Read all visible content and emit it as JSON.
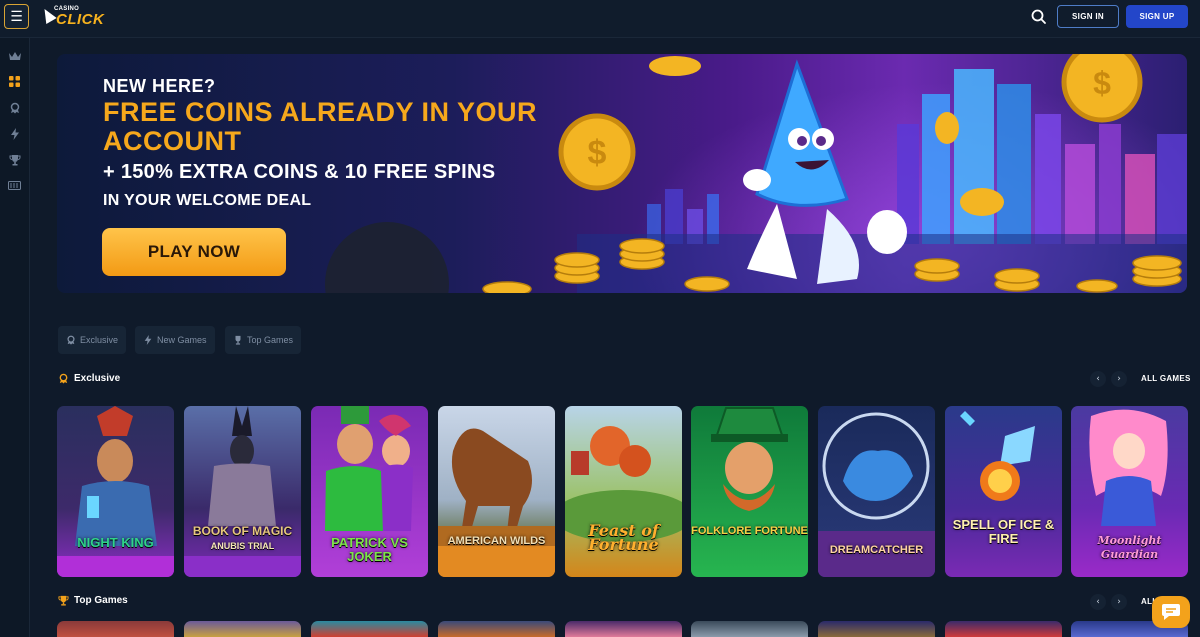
{
  "header": {
    "logo_small": "CASINO",
    "logo_main": "CLICK",
    "sign_in": "SIGN IN",
    "sign_up": "SIGN UP"
  },
  "sidebar": {
    "icons": [
      "crown-icon",
      "grid-icon",
      "exclusive-icon",
      "lightning-icon",
      "trophy-icon",
      "ticket-icon"
    ]
  },
  "hero": {
    "line1": "NEW HERE?",
    "line2": "FREE COINS ALREADY IN YOUR ACCOUNT",
    "line3": "+ 150% EXTRA COINS & 10 FREE SPINS",
    "line4": "IN YOUR WELCOME DEAL",
    "cta": "PLAY NOW"
  },
  "filters": [
    {
      "label": "Exclusive",
      "icon": "exclusive-icon"
    },
    {
      "label": "New Games",
      "icon": "lightning-icon"
    },
    {
      "label": "Top Games",
      "icon": "trophy-icon"
    }
  ],
  "sections": {
    "exclusive": {
      "title": "Exclusive",
      "all": "ALL GAMES"
    },
    "top_games": {
      "title": "Top Games",
      "all": "ALL"
    }
  },
  "games": [
    {
      "title": "NIGHT KING",
      "color": "#2fd38a"
    },
    {
      "title": "BOOK OF MAGIC",
      "subtitle": "ANUBIS TRIAL",
      "color": "#e7c77d"
    },
    {
      "title": "PATRICK VS JOKER",
      "color": "#7de34a"
    },
    {
      "title": "AMERICAN WILDS",
      "color": "#f2dfb5"
    },
    {
      "title": "Feast of Fortune",
      "color": "#ffb02e"
    },
    {
      "title": "FOLKLORE FORTUNE",
      "color": "#f7d046"
    },
    {
      "title": "DREAMCATCHER",
      "color": "#ffd4a0"
    },
    {
      "title": "SPELL OF ICE & FIRE",
      "color": "#fff0b0"
    },
    {
      "title": "Moonlight Guardian",
      "color": "#ff9ad8"
    }
  ]
}
